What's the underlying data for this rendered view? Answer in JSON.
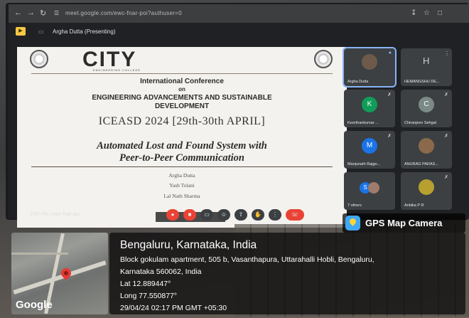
{
  "browser": {
    "url": "meet.google.com/ewc-fnar-poi?authuser=0"
  },
  "meet": {
    "presenter_label": "Argha Dutta (Presenting)",
    "meeting_info": "3:06 PM  |  ewc-fnar-poi"
  },
  "slide": {
    "college_name": "CITY",
    "college_subtitle": "ENGINEERING COLLEGE",
    "conference_line1": "International Conference",
    "conference_line2": "on",
    "conference_line3": "ENGINEERING ADVANCEMENTS AND SUSTAINABLE",
    "conference_line4": "DEVELOPMENT",
    "event_name": "ICEASD 2024  [29th-30th APRIL]",
    "paper_title_line1": "Automated Lost and Found System with",
    "paper_title_line2": "Peer-to-Peer Communication",
    "author1": "Argha Dutta",
    "author2": "Yash Tolani",
    "author3": "Lal Nath Sharma"
  },
  "participants": [
    {
      "name": "Argha Dutta",
      "initial": "",
      "color": "#6d5a4a"
    },
    {
      "name": "HEMANGSHU DE...",
      "initial": "H",
      "color": ""
    },
    {
      "name": "Keerthankumar ...",
      "initial": "K",
      "color": "#0f9d58"
    },
    {
      "name": "Chiranjeev Sehgal",
      "initial": "C",
      "color": "#7b8a86"
    },
    {
      "name": "Manjunath Rajgo...",
      "initial": "M",
      "color": "#1a73e8"
    },
    {
      "name": "ANURAG PARAS...",
      "initial": "",
      "color": "#8a6a4a"
    },
    {
      "name": "7 others",
      "initial": "S",
      "color": "#1a73e8"
    },
    {
      "name": "Anbika P R",
      "initial": "",
      "color": "#b8a030"
    }
  ],
  "gps": {
    "badge_label": "GPS Map Camera",
    "city_line": "Bengaluru, Karnataka, India",
    "address_line1": "Block gokulam apartment, 505 b, Vasanthapura, Uttarahalli Hobli, Bengaluru,",
    "address_line2": "Karnataka 560062, India",
    "lat": "Lat 12.889447°",
    "long": "Long 77.550877°",
    "timestamp": "29/04/24 02:17 PM GMT +05:30",
    "map_brand": "Google"
  },
  "colors": {
    "meet_bg": "#202124",
    "end_call": "#ea4335",
    "pin": "#e53935"
  }
}
